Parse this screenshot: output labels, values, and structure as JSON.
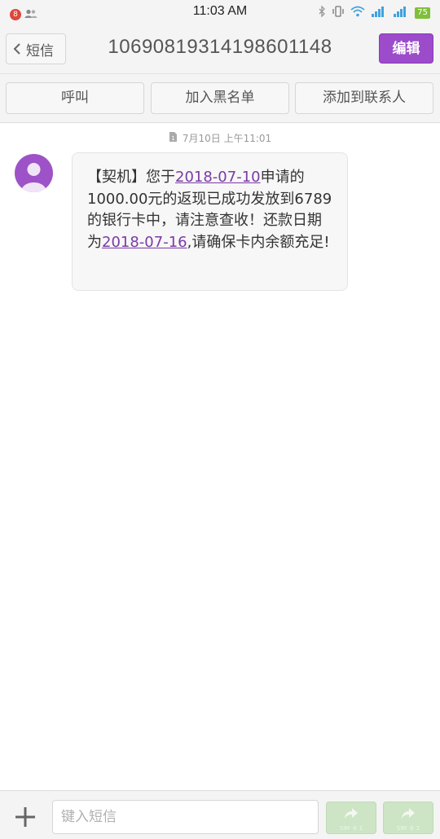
{
  "status_bar": {
    "notification_count": "8",
    "time": "11:03 AM",
    "battery": "75"
  },
  "header": {
    "back_label": "短信",
    "title": "10690819314198601148",
    "edit_label": "编辑"
  },
  "actions": {
    "call": "呼叫",
    "blacklist": "加入黑名单",
    "add_contact": "添加到联系人"
  },
  "conversation": {
    "timestamp": "7月10日 上午11:01",
    "message": {
      "part1": "【契机】您于",
      "date1": "2018-07-10",
      "part2": "申请的1000.00元的返现已成功发放到6789的银行卡中，请注意查收！还款日期为",
      "date2": "2018-07-16",
      "part3": ",请确保卡内余额充足!"
    }
  },
  "composer": {
    "placeholder": "键入短信",
    "sim1_label": "SIM 卡 1",
    "sim2_label": "SIM 卡 2"
  },
  "colors": {
    "accent": "#9c4bcb",
    "link": "#7b3aa6",
    "send_disabled": "#cde4c5"
  }
}
